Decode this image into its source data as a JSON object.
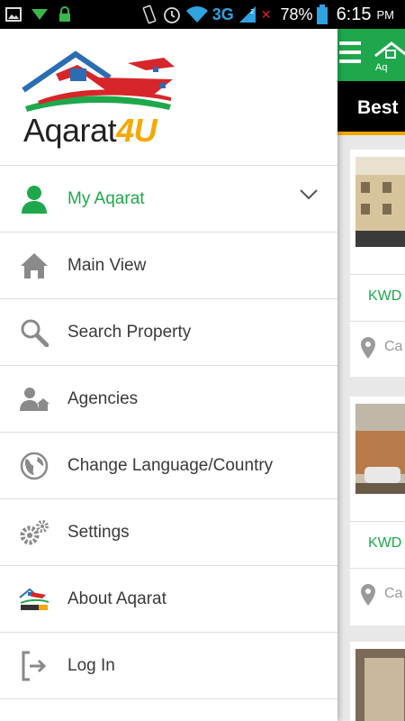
{
  "status_bar": {
    "network": "3G",
    "battery": "78%",
    "time": "6:15",
    "ampm": "PM",
    "icons": [
      "image-icon",
      "download-icon",
      "lock-icon",
      "vibrate-icon",
      "alarm-icon",
      "wifi-icon",
      "signal-icon",
      "battery-icon"
    ]
  },
  "drawer": {
    "logo": {
      "text_main": "Aqarat",
      "text_suffix": "4U"
    },
    "items": [
      {
        "label": "My Aqarat",
        "icon": "user-icon",
        "active": true
      },
      {
        "label": "Main View",
        "icon": "home-icon"
      },
      {
        "label": "Search Property",
        "icon": "search-icon"
      },
      {
        "label": "Agencies",
        "icon": "agency-icon"
      },
      {
        "label": "Change Language/Country",
        "icon": "globe-icon"
      },
      {
        "label": "Settings",
        "icon": "gears-icon"
      },
      {
        "label": "About Aqarat",
        "icon": "aqarat-logo-icon"
      },
      {
        "label": "Log In",
        "icon": "login-icon"
      }
    ]
  },
  "background": {
    "tab_label": "Best",
    "cards": [
      {
        "price": "KWD",
        "location": "Ca"
      },
      {
        "price": "KWD",
        "location": "Ca"
      }
    ]
  },
  "colors": {
    "brand_green": "#1ea84b",
    "brand_orange": "#f5a800",
    "brand_red": "#d7262a",
    "brand_blue": "#2a6db3"
  }
}
